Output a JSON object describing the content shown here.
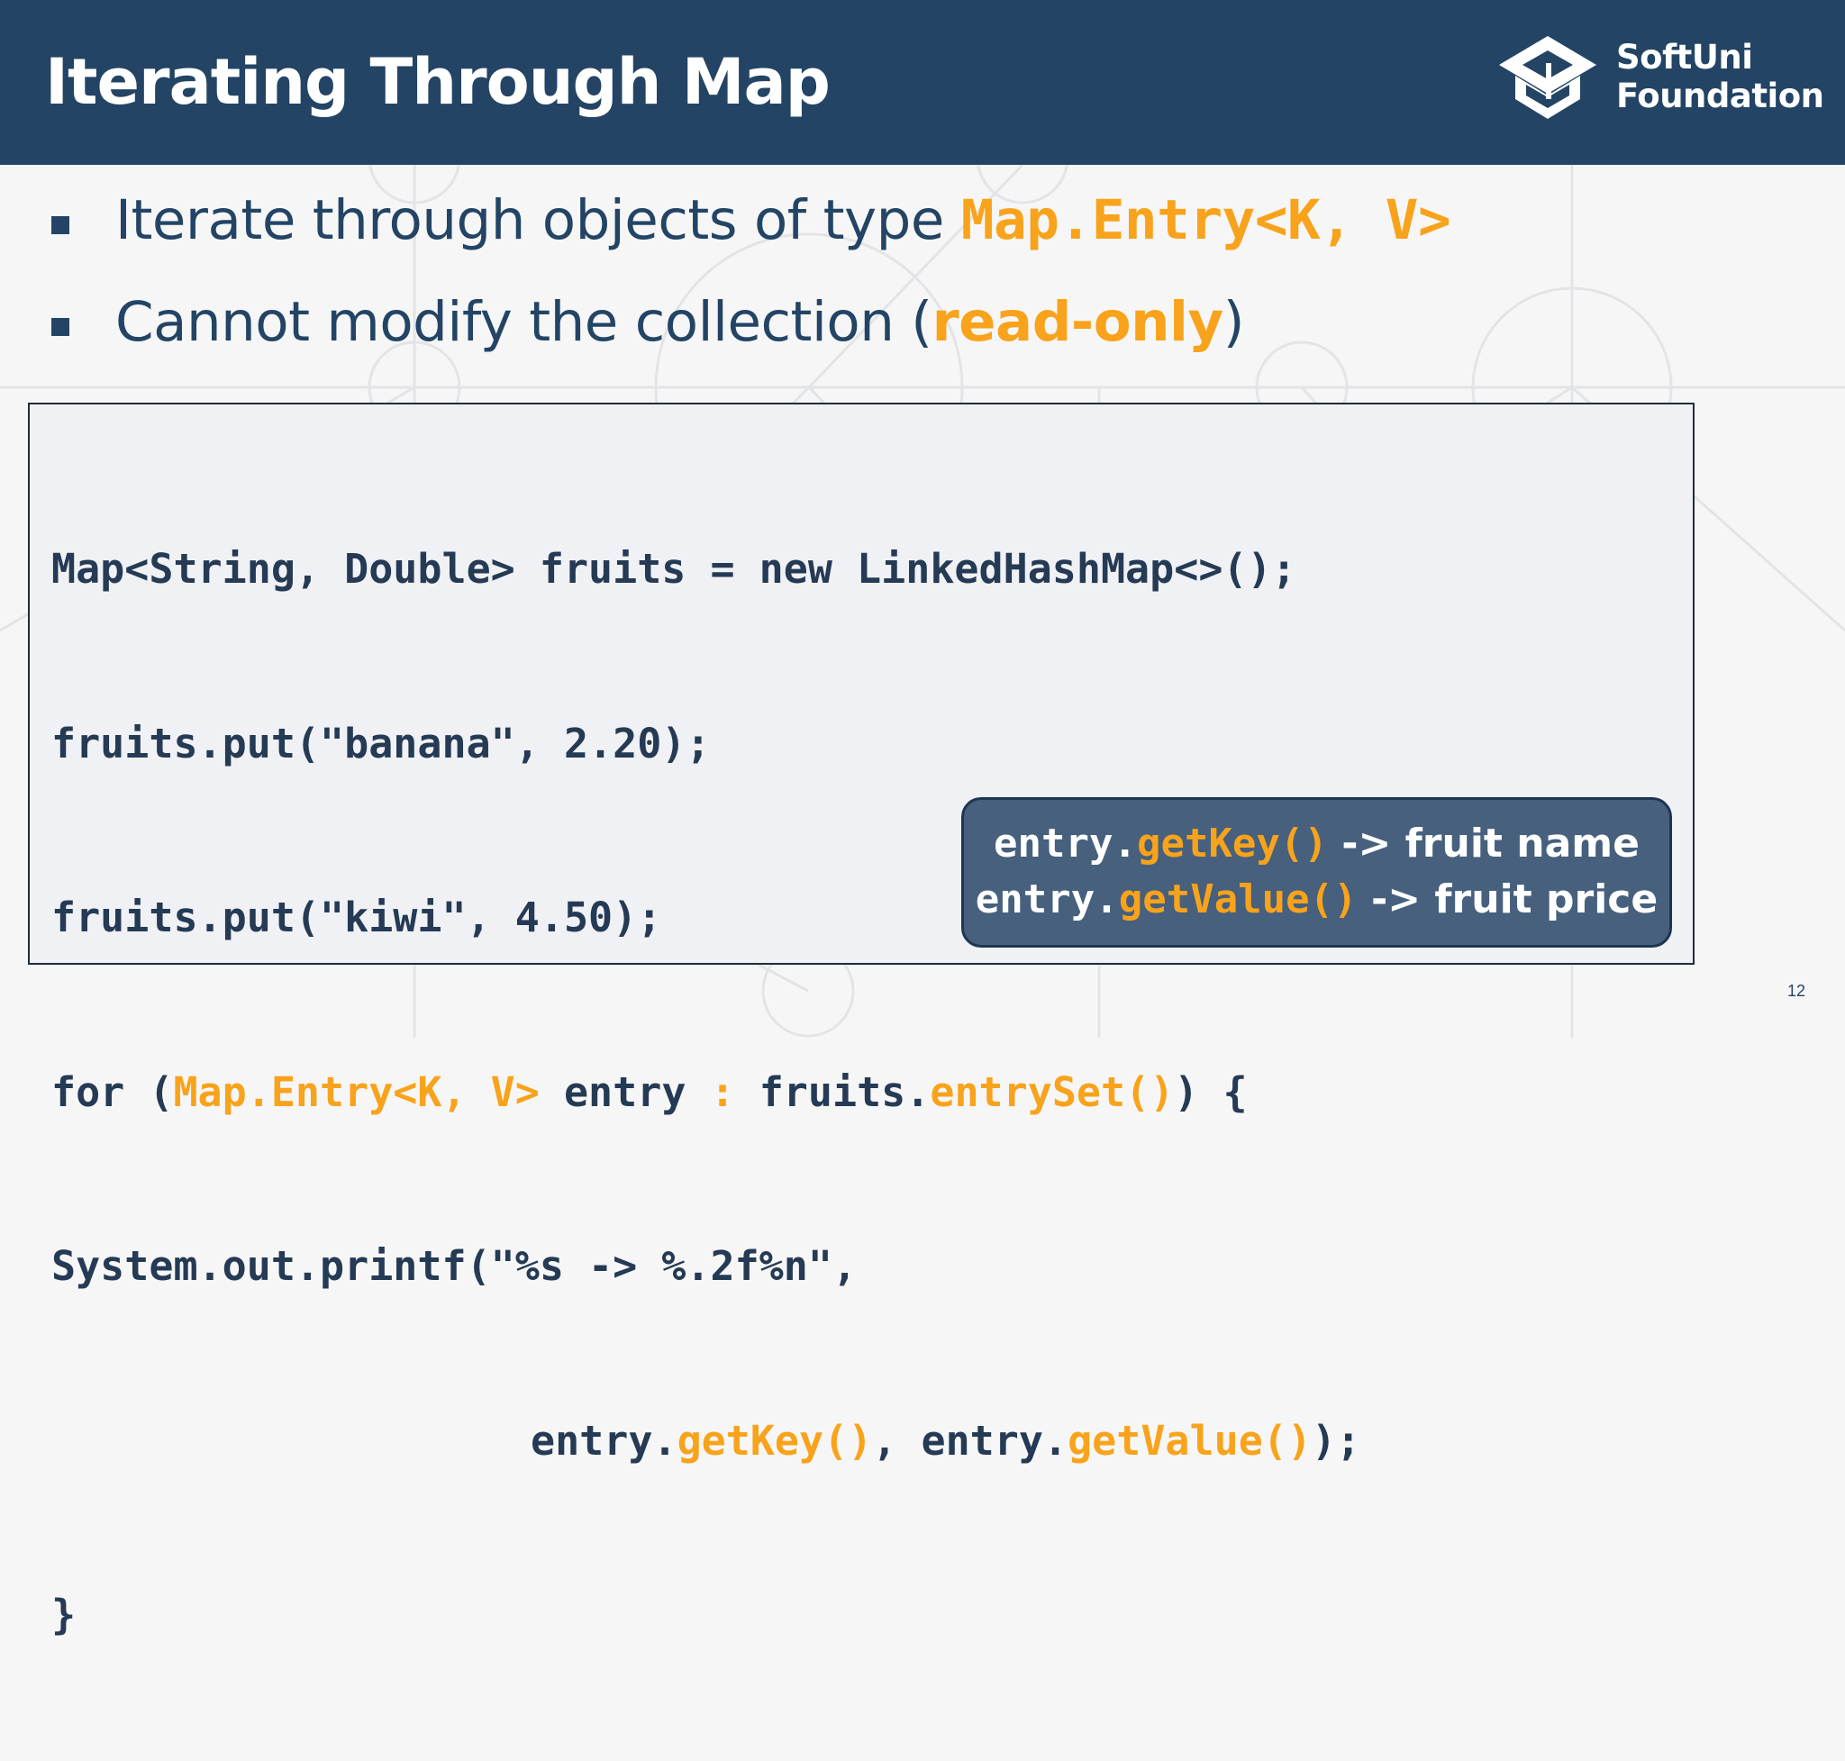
{
  "slide": {
    "title": "Iterating Through Map",
    "page_number": "12"
  },
  "logo": {
    "line1": "SoftUni",
    "line2": "Foundation",
    "icon": "graduation-cap-icon"
  },
  "bullets": [
    {
      "text": "Iterate through objects of type ",
      "highlight": "Map.Entry<K, V>"
    },
    {
      "text_before": "Cannot modify the collection (",
      "highlight": "read-only",
      "text_after": ")"
    }
  ],
  "code": {
    "line1": "Map<String, Double> fruits = new LinkedHashMap<>();",
    "line2": "fruits.put(\"banana\", 2.20);",
    "line3": "fruits.put(\"kiwi\", 4.50);",
    "line4": {
      "a": "for (",
      "b": "Map.Entry<K, V>",
      "c": " entry ",
      "d": ":",
      "e": " fruits.",
      "f": "entrySet()",
      "g": ") {"
    },
    "line5": "System.out.printf(\"%s -> %.2f%n\",",
    "line6": {
      "a": "entry.",
      "b": "getKey()",
      "c": ", entry.",
      "d": "getValue()",
      "e": ");"
    },
    "line7": "}"
  },
  "tooltip": {
    "line1": {
      "obj": "entry.",
      "method": "getKey()",
      "desc": " -> fruit name"
    },
    "line2": {
      "obj": "entry.",
      "method": "getValue()",
      "desc": " -> fruit price"
    }
  },
  "colors": {
    "header_bg": "#234465",
    "accent": "#f8a31b",
    "code_text": "#253a54",
    "tooltip_bg": "#46607e"
  }
}
